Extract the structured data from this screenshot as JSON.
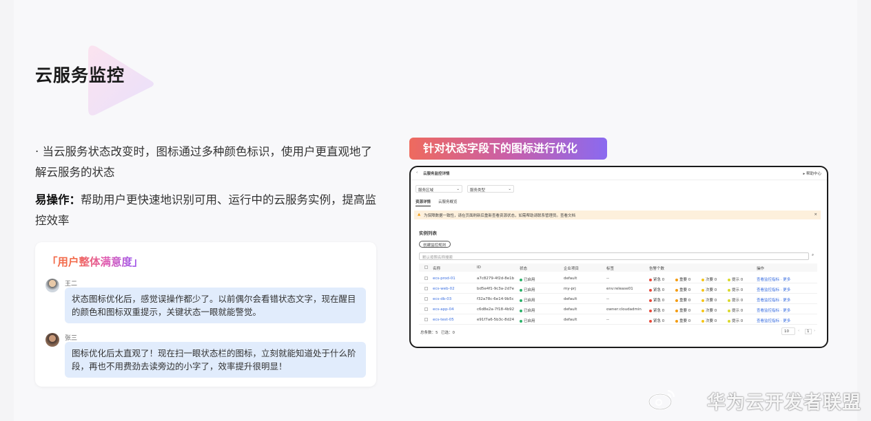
{
  "title": "云服务监控",
  "bullet": "· 当云服务状态改变时，图标通过多种颜色标识，使用户更直观地了解云服务的状态",
  "ease": {
    "label": "易操作：",
    "text": "帮助用户更快速地识别可用、运行中的云服务实例，提高监控效率"
  },
  "feedback": {
    "title_open": "「",
    "title_q1": "用户",
    "title_grad": "整体满意度",
    "title_close": "」",
    "comments": [
      {
        "user": "王二",
        "text": "状态图标优化后，感觉误操作都少了。以前偶尔会看错状态文字，现在醒目的颜色和图标双重提示，关键状态一眼就能警觉。"
      },
      {
        "user": "张三",
        "text": "图标优化后太直观了！现在扫一眼状态栏的图标，立刻就能知道处于什么阶段，再也不用费劲去读旁边的小字了，效率提升很明显！"
      }
    ]
  },
  "tag": "针对状态字段下的图标进行优化",
  "screen": {
    "header_title": "云服务监控详情",
    "header_right": "▸ 帮助中心",
    "filter1": "服务区域",
    "filter2": "服务类型",
    "tabs": [
      "资源详情",
      "云服务概览"
    ],
    "warning": "为保障数据一致性，请在页面刷新后重新查看资源状态，如需帮助请联系管理员。查看文档",
    "list_title": "实例列表",
    "create_btn": "创建监控规则",
    "search_placeholder": "默认按照名称搜索",
    "columns": [
      "名称",
      "ID",
      "状态",
      "企业项目",
      "标签",
      "告警个数",
      "操作"
    ],
    "rows": [
      {
        "name": "ecs-prod-01",
        "id": "a7c8279-4f2d-8e1b",
        "status": "已启用",
        "project": "default",
        "tag": "--",
        "ops": "查看监控指标 · 更多"
      },
      {
        "name": "ecs-web-02",
        "id": "bd5e4f1-9c3a-2d7e",
        "status": "已启用",
        "project": "my-prj",
        "tag": "env:release01",
        "ops": "查看监控指标 · 更多"
      },
      {
        "name": "ecs-db-03",
        "id": "f32a78c-6e14-9b5c",
        "status": "已启用",
        "project": "default",
        "tag": "--",
        "ops": "查看监控指标 · 更多"
      },
      {
        "name": "ecs-app-04",
        "id": "c6d8e2a-7f18-4b92",
        "status": "已启用",
        "project": "default",
        "tag": "owner:cloudadmin",
        "ops": "查看监控指标 · 更多"
      },
      {
        "name": "ecs-test-05",
        "id": "e91f7a6-5b3c-8d24",
        "status": "已启用",
        "project": "default",
        "tag": "--",
        "ops": "查看监控指标 · 更多"
      }
    ],
    "alarms": [
      {
        "label": "紧急",
        "value": "0",
        "color": "#e64a3b"
      },
      {
        "label": "重要",
        "value": "0",
        "color": "#f39c12"
      },
      {
        "label": "次要",
        "value": "0",
        "color": "#f5c518"
      },
      {
        "label": "提示",
        "value": "0",
        "color": "#d9d92b"
      }
    ],
    "status_color": "#2cb36a",
    "footer_total": "总条数：5",
    "footer_selected": "已选：0",
    "page_size": "10",
    "page": "1"
  },
  "watermark": "华为云开发者联盟"
}
